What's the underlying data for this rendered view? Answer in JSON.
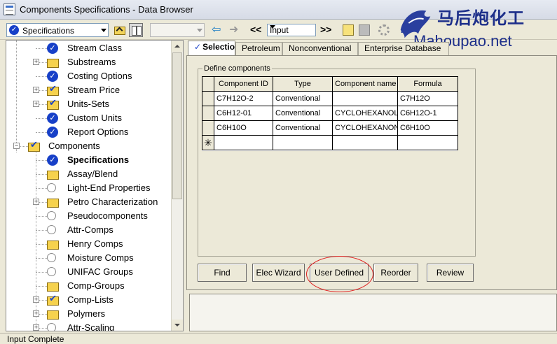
{
  "window": {
    "title": "Components Specifications - Data Browser"
  },
  "toolbar": {
    "form_select": "Specifications",
    "mode_select": "Input",
    "back_glyph": "⇦",
    "forward_glyph": "➜",
    "prev_glyph": "<<",
    "next_glyph": ">>",
    "next_form_label": "N>"
  },
  "watermark": {
    "brand_cn": "马后炮化工",
    "url": "Mahoupao.net"
  },
  "tree": {
    "items": [
      {
        "label": "Stream Class",
        "icon": "done-icon",
        "expandable": false,
        "level": 1
      },
      {
        "label": "Substreams",
        "icon": "folder-icon",
        "expandable": true,
        "level": 1
      },
      {
        "label": "Costing Options",
        "icon": "done-icon",
        "expandable": false,
        "level": 1
      },
      {
        "label": "Stream Price",
        "icon": "folder-check-icon",
        "expandable": true,
        "level": 1
      },
      {
        "label": "Units-Sets",
        "icon": "folder-check-icon",
        "expandable": true,
        "level": 1
      },
      {
        "label": "Custom Units",
        "icon": "done-icon",
        "expandable": false,
        "level": 1
      },
      {
        "label": "Report Options",
        "icon": "done-icon",
        "expandable": false,
        "level": 1
      },
      {
        "label": "Components",
        "icon": "folder-check-icon",
        "expandable": true,
        "expanded": true,
        "level": 0
      },
      {
        "label": "Specifications",
        "icon": "done-icon",
        "expandable": false,
        "level": 1,
        "selected": true
      },
      {
        "label": "Assay/Blend",
        "icon": "folder-icon",
        "expandable": false,
        "level": 1
      },
      {
        "label": "Light-End Properties",
        "icon": "empty-icon",
        "expandable": false,
        "level": 1
      },
      {
        "label": "Petro Characterization",
        "icon": "folder-icon",
        "expandable": true,
        "level": 1
      },
      {
        "label": "Pseudocomponents",
        "icon": "empty-icon",
        "expandable": false,
        "level": 1
      },
      {
        "label": "Attr-Comps",
        "icon": "empty-icon",
        "expandable": false,
        "level": 1
      },
      {
        "label": "Henry Comps",
        "icon": "folder-icon",
        "expandable": false,
        "level": 1
      },
      {
        "label": "Moisture Comps",
        "icon": "empty-icon",
        "expandable": false,
        "level": 1
      },
      {
        "label": "UNIFAC Groups",
        "icon": "empty-icon",
        "expandable": false,
        "level": 1
      },
      {
        "label": "Comp-Groups",
        "icon": "folder-icon",
        "expandable": false,
        "level": 1
      },
      {
        "label": "Comp-Lists",
        "icon": "folder-check-icon",
        "expandable": true,
        "level": 1
      },
      {
        "label": "Polymers",
        "icon": "folder-icon",
        "expandable": true,
        "level": 1
      },
      {
        "label": "Attr-Scaling",
        "icon": "empty-icon",
        "expandable": true,
        "level": 1
      }
    ]
  },
  "tabs": [
    {
      "label": "Selection",
      "active": true
    },
    {
      "label": "Petroleum",
      "active": false
    },
    {
      "label": "Nonconventional",
      "active": false
    },
    {
      "label": "Enterprise Database",
      "active": false
    }
  ],
  "define_components": {
    "caption": "Define components",
    "columns": [
      "Component ID",
      "Type",
      "Component name",
      "Formula"
    ],
    "rows": [
      [
        "C7H12O-2",
        "Conventional",
        "",
        "C7H12O"
      ],
      [
        "C6H12-01",
        "Conventional",
        "CYCLOHEXANOL",
        "C6H12O-1"
      ],
      [
        "C6H10O",
        "Conventional",
        "CYCLOHEXANONE",
        "C6H10O"
      ]
    ],
    "new_row_marker": "✳"
  },
  "buttons": {
    "find": "Find",
    "elec_wizard": "Elec Wizard",
    "user_defined": "User Defined",
    "reorder": "Reorder",
    "review": "Review"
  },
  "status": {
    "text": "Input Complete"
  },
  "colors": {
    "accent": "#1740c8",
    "highlight": "#e02020",
    "brand": "#1d2f8a"
  }
}
